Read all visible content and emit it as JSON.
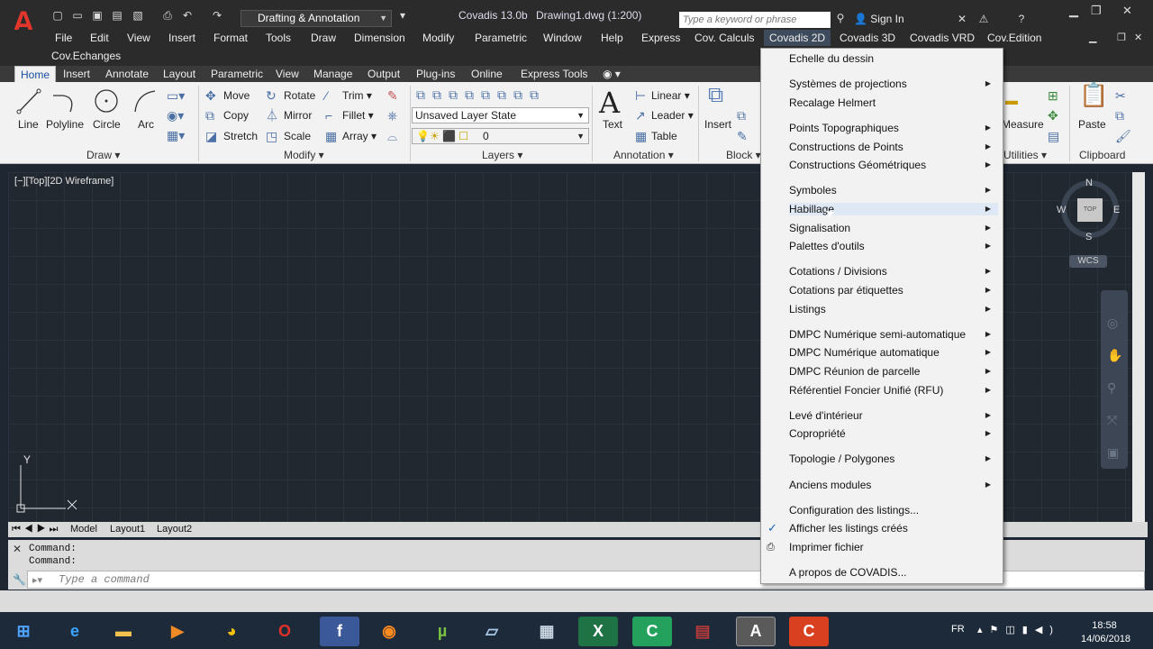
{
  "titlebar": {
    "app_name": "Covadis 13.0b",
    "document": "Drawing1.dwg (1:200)",
    "workspace": "Drafting & Annotation",
    "search_placeholder": "Type a keyword or phrase",
    "signin": "Sign In"
  },
  "menubar": {
    "items": [
      "File",
      "Edit",
      "View",
      "Insert",
      "Format",
      "Tools",
      "Draw",
      "Dimension",
      "Modify",
      "Parametric",
      "Window",
      "Help",
      "Express",
      "Cov. Calculs",
      "Covadis 2D",
      "Covadis 3D",
      "Covadis VRD",
      "Cov.Edition"
    ],
    "second_row": "Cov.Echanges",
    "active": "Covadis 2D"
  },
  "ribbon": {
    "tabs": [
      "Home",
      "Insert",
      "Annotate",
      "Layout",
      "Parametric",
      "View",
      "Manage",
      "Output",
      "Plug-ins",
      "Online",
      "Express Tools"
    ],
    "active_tab": "Home",
    "draw": {
      "title": "Draw",
      "tools": [
        "Line",
        "Polyline",
        "Circle",
        "Arc"
      ]
    },
    "modify": {
      "title": "Modify",
      "tools": [
        "Move",
        "Rotate",
        "Trim",
        "Copy",
        "Mirror",
        "Fillet",
        "Stretch",
        "Scale",
        "Array"
      ]
    },
    "layers": {
      "title": "Layers",
      "layer_state": "Unsaved Layer State",
      "current_layer": "0"
    },
    "annotation": {
      "title": "Annotation",
      "text": "Text",
      "linear": "Linear",
      "leader": "Leader",
      "table": "Table"
    },
    "block": {
      "title": "Block",
      "insert": "Insert"
    },
    "utilities": {
      "title": "Utilities",
      "measure": "Measure"
    },
    "clipboard": {
      "title": "Clipboard",
      "paste": "Paste"
    }
  },
  "viewport": {
    "label": "[−][Top][2D Wireframe]",
    "compass": {
      "n": "N",
      "s": "S",
      "e": "E",
      "w": "W",
      "top": "TOP"
    },
    "wcs": "WCS",
    "ucs_y": "Y"
  },
  "layout_tabs": [
    "Model",
    "Layout1",
    "Layout2"
  ],
  "command": {
    "history": [
      "Command:",
      "Command:"
    ],
    "placeholder": "Type a command"
  },
  "dropdown": {
    "items": [
      {
        "label": "Echelle du dessin",
        "submenu": false
      },
      {
        "label": "Systèmes de projections",
        "submenu": true
      },
      {
        "label": "Recalage Helmert",
        "submenu": false
      },
      {
        "label": "Points Topographiques",
        "submenu": true
      },
      {
        "label": "Constructions de Points",
        "submenu": true
      },
      {
        "label": "Constructions Géométriques",
        "submenu": true
      },
      {
        "label": "Symboles",
        "submenu": true
      },
      {
        "label": "Habillage",
        "submenu": true
      },
      {
        "label": "Signalisation",
        "submenu": true
      },
      {
        "label": "Palettes d'outils",
        "submenu": true
      },
      {
        "label": "Cotations / Divisions",
        "submenu": true
      },
      {
        "label": "Cotations par étiquettes",
        "submenu": true
      },
      {
        "label": "Listings",
        "submenu": true
      },
      {
        "label": "DMPC Numérique semi-automatique",
        "submenu": true
      },
      {
        "label": "DMPC Numérique automatique",
        "submenu": true
      },
      {
        "label": "DMPC Réunion de parcelle",
        "submenu": true
      },
      {
        "label": "Référentiel Foncier Unifié (RFU)",
        "submenu": true
      },
      {
        "label": "Levé d'intérieur",
        "submenu": true
      },
      {
        "label": "Copropriété",
        "submenu": true
      },
      {
        "label": "Topologie / Polygones",
        "submenu": true
      },
      {
        "label": "Anciens modules",
        "submenu": true
      },
      {
        "label": "Configuration des listings...",
        "submenu": false
      },
      {
        "label": "Afficher les listings créés",
        "submenu": false
      },
      {
        "label": "Imprimer fichier",
        "submenu": false
      },
      {
        "label": "A propos de COVADIS...",
        "submenu": false
      }
    ],
    "hovered": "Habillage"
  },
  "taskbar": {
    "language": "FR",
    "time": "18:58",
    "date": "14/06/2018"
  }
}
